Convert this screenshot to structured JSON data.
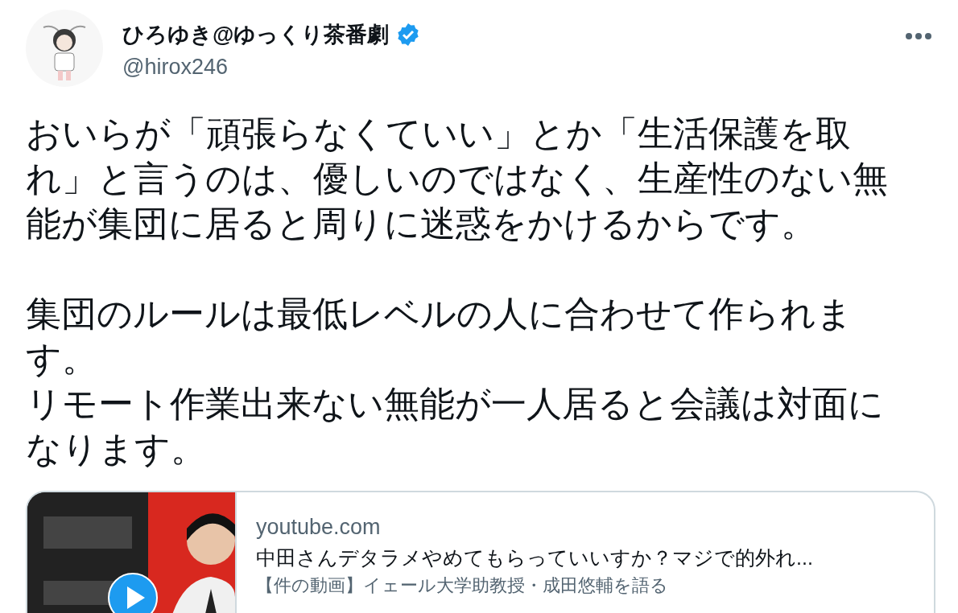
{
  "author": {
    "name": "ひろゆき@ゆっくり茶番劇",
    "verified": true,
    "handle": "@hirox246"
  },
  "body": [
    [
      "おいらが「頑張らなくていい」とか「生活保護を取れ」と言うのは、優しいのではなく、生産性のない無能が集団に居ると周りに迷惑をかけるからです。"
    ],
    [
      "集団のルールは最低レベルの人に合わせて作られます。",
      "リモート作業出来ない無能が一人居ると会議は対面になります。"
    ]
  ],
  "link_card": {
    "domain": "youtube.com",
    "title": "中田さんデタラメやめてもらっていいすか？マジで的外れ...",
    "description": "【件の動画】イェール大学助教授・成田悠輔を語る"
  }
}
